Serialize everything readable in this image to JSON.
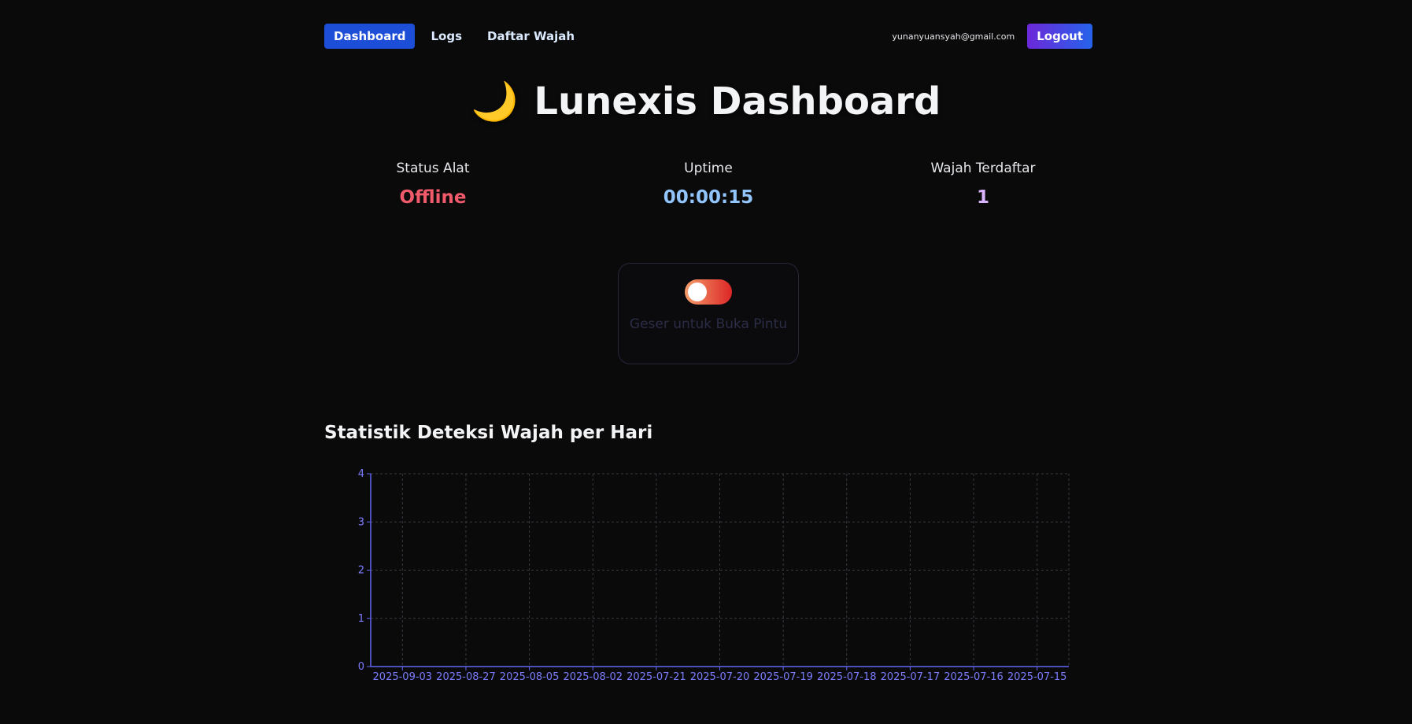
{
  "nav": {
    "links": [
      {
        "label": "Dashboard",
        "active": true
      },
      {
        "label": "Logs",
        "active": false
      },
      {
        "label": "Daftar Wajah",
        "active": false
      }
    ],
    "user_email": "yunanyuansyah@gmail.com",
    "logout_label": "Logout"
  },
  "header": {
    "icon": "🌙",
    "title": "Lunexis Dashboard"
  },
  "stats": {
    "status": {
      "label": "Status Alat",
      "value": "Offline"
    },
    "uptime": {
      "label": "Uptime",
      "value": "00:00:15"
    },
    "faces": {
      "label": "Wajah Terdaftar",
      "value": "1"
    }
  },
  "door": {
    "label": "Geser untuk Buka Pintu",
    "toggle_on": false
  },
  "chart_section": {
    "title": "Statistik Deteksi Wajah per Hari"
  },
  "colors": {
    "accent": "#1d4ed8",
    "offline": "#f05a6b",
    "uptime": "#93c5fd",
    "faces": "#d8b4fe",
    "axis": "#6366f1"
  },
  "chart_data": {
    "type": "bar",
    "categories": [
      "2025-09-03",
      "2025-08-27",
      "2025-08-05",
      "2025-08-02",
      "2025-07-21",
      "2025-07-20",
      "2025-07-19",
      "2025-07-18",
      "2025-07-17",
      "2025-07-16",
      "2025-07-15"
    ],
    "values": [
      0,
      0,
      0,
      0,
      0,
      0,
      0,
      0,
      0,
      0,
      0
    ],
    "yticks": [
      0,
      1,
      2,
      3,
      4
    ],
    "ylim": [
      0,
      4
    ],
    "grid": true,
    "title": "",
    "xlabel": "",
    "ylabel": ""
  }
}
